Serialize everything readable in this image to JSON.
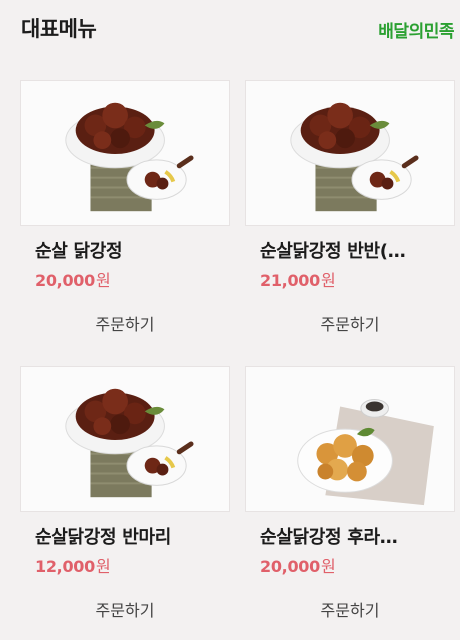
{
  "header": {
    "title": "대표메뉴",
    "brand_link": "배달의민족"
  },
  "menu": [
    {
      "name": "순살 닭강정",
      "price": "20,000",
      "currency": "원",
      "order_label": "주문하기",
      "image": "glazed-chicken-dish"
    },
    {
      "name": "순살닭강정 반반(…",
      "price": "21,000",
      "currency": "원",
      "order_label": "주문하기",
      "image": "glazed-chicken-dish"
    },
    {
      "name": "순살닭강정 반마리",
      "price": "12,000",
      "currency": "원",
      "order_label": "주문하기",
      "image": "glazed-chicken-dish"
    },
    {
      "name": "순살닭강정 후라…",
      "price": "20,000",
      "currency": "원",
      "order_label": "주문하기",
      "image": "fried-chicken-dish"
    }
  ],
  "colors": {
    "brand_green": "#2aa031",
    "price_red": "#e0606a",
    "background": "#f3f1f1"
  }
}
